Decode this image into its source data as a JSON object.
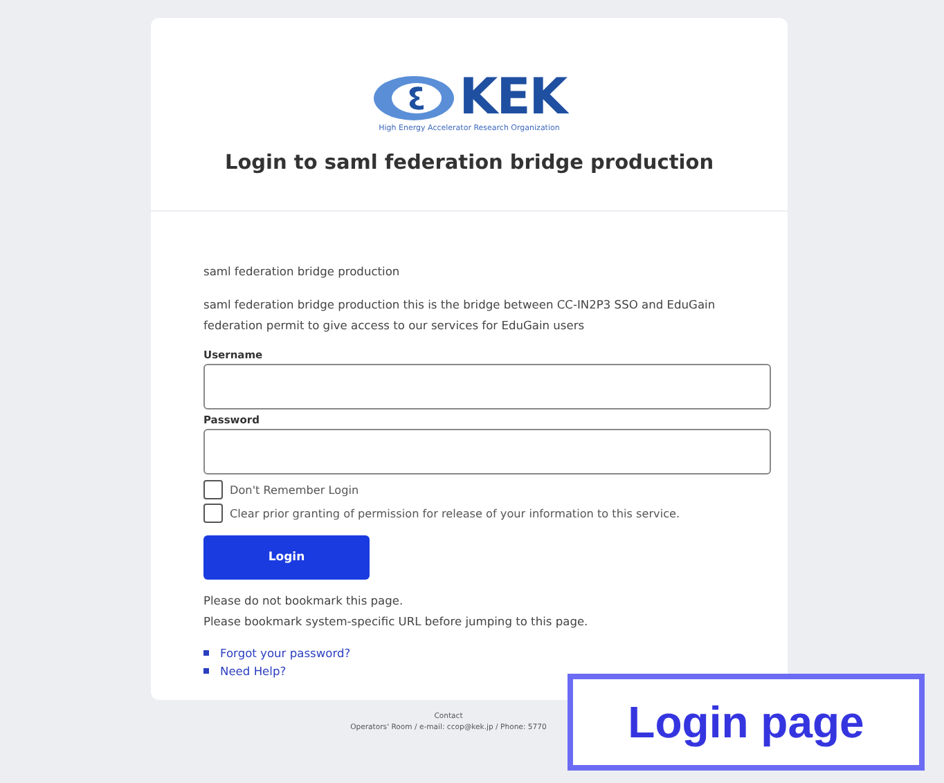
{
  "logo": {
    "wordmark": "KEK",
    "subtitle": "High Energy Accelerator Research Organization"
  },
  "heading": "Login to saml federation bridge production",
  "service_name": "saml federation bridge production",
  "description": "saml federation bridge production this is the bridge between CC-IN2P3 SSO and EduGain federation permit to give access to our services for EduGain users",
  "fields": [
    {
      "label": "Username"
    },
    {
      "label": "Password"
    }
  ],
  "checkboxes": [
    {
      "label": "Don't Remember Login",
      "checked": false
    },
    {
      "label": "Clear prior granting of permission for release of your information to this service.",
      "checked": false
    }
  ],
  "login_button": "Login",
  "notes": [
    "Please do not bookmark this page.",
    "Please bookmark system-specific URL before jumping to this page."
  ],
  "links": [
    "Forgot your password?",
    "Need Help?"
  ],
  "footer": {
    "title": "Contact",
    "line": "Operators' Room / e-mail: ccop@kek.jp / Phone: 5770"
  },
  "callout": "Login page"
}
